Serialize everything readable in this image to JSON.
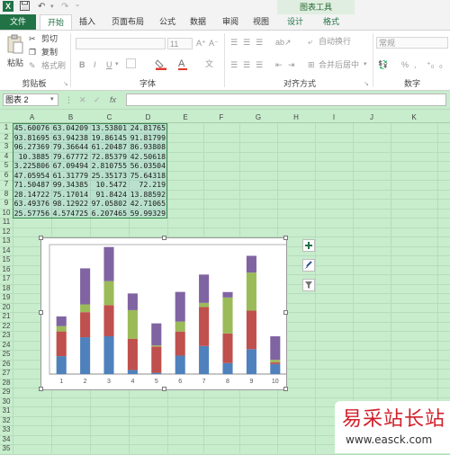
{
  "quick_access": {
    "save_icon": "save-icon",
    "undo": "↶",
    "redo": "↷"
  },
  "chart_tools_label": "图表工具",
  "tabs": [
    {
      "label": "文件",
      "kind": "file"
    },
    {
      "label": "开始",
      "kind": "active"
    },
    {
      "label": "插入",
      "kind": "normal"
    },
    {
      "label": "页面布局",
      "kind": "normal"
    },
    {
      "label": "公式",
      "kind": "normal"
    },
    {
      "label": "数据",
      "kind": "normal"
    },
    {
      "label": "审阅",
      "kind": "normal"
    },
    {
      "label": "视图",
      "kind": "normal"
    },
    {
      "label": "设计",
      "kind": "ctx"
    },
    {
      "label": "格式",
      "kind": "ctx"
    }
  ],
  "ribbon": {
    "paste_label": "粘贴",
    "cut_label": "剪切",
    "copy_label": "复制",
    "format_painter_label": "格式刷",
    "clipboard_group": "剪贴板",
    "font_size": "11",
    "bold": "B",
    "italic": "I",
    "underline": "U",
    "font_group": "字体",
    "wrap_text_label": "自动换行",
    "merge_label": "合并后居中",
    "alignment_group": "对齐方式",
    "number_format": "常规",
    "percent": "%",
    "number_group": "数字"
  },
  "formula_bar": {
    "name_box": "图表 2",
    "fx": "fx"
  },
  "columns": [
    "A",
    "B",
    "C",
    "D",
    "E",
    "F",
    "G",
    "H",
    "I",
    "J",
    "K"
  ],
  "rows": [
    1,
    2,
    3,
    4,
    5,
    6,
    7,
    8,
    9,
    10,
    11,
    12,
    13,
    14,
    15,
    16,
    17,
    18,
    19,
    20,
    21,
    22,
    23,
    24,
    25,
    26,
    27,
    28,
    29,
    30,
    31,
    32,
    33,
    34,
    35,
    36
  ],
  "table": [
    [
      "45.60076",
      "63.04209",
      "13.53801",
      "24.81765"
    ],
    [
      "93.81695",
      "63.94238",
      "19.86145",
      "91.81799"
    ],
    [
      "96.27369",
      "79.36644",
      "61.20487",
      "86.93808"
    ],
    [
      "10.3885",
      "79.67772",
      "72.85379",
      "42.50618"
    ],
    [
      "3.225806",
      "67.09494",
      "2.810755",
      "56.03504"
    ],
    [
      "47.05954",
      "61.31779",
      "25.35173",
      "75.64318"
    ],
    [
      "71.50487",
      "99.34385",
      "10.5472",
      "72.219"
    ],
    [
      "28.14722",
      "75.17014",
      "91.8424",
      "13.88592"
    ],
    [
      "63.49376",
      "98.12922",
      "97.05802",
      "42.71065"
    ],
    [
      "25.57756",
      "4.574725",
      "6.207465",
      "59.99329"
    ]
  ],
  "chart_data": {
    "type": "bar",
    "stacked": true,
    "categories": [
      "1",
      "2",
      "3",
      "4",
      "5",
      "6",
      "7",
      "8",
      "9",
      "10"
    ],
    "series": [
      {
        "values": [
          45.60076,
          93.81695,
          96.27369,
          10.3885,
          3.225806,
          47.05954,
          71.50487,
          28.14722,
          63.49376,
          25.57756
        ],
        "color": "#4f81bd"
      },
      {
        "values": [
          63.04209,
          63.94238,
          79.36644,
          79.67772,
          67.09494,
          61.31779,
          99.34385,
          75.17014,
          98.12922,
          4.574725
        ],
        "color": "#c0504d"
      },
      {
        "values": [
          13.53801,
          19.86145,
          61.20487,
          72.85379,
          2.810755,
          25.35173,
          10.5472,
          91.8424,
          97.05802,
          6.207465
        ],
        "color": "#9bbb59"
      },
      {
        "values": [
          24.81765,
          91.81799,
          86.93808,
          42.50618,
          56.03504,
          75.64318,
          72.219,
          13.88592,
          42.71065,
          59.99329
        ],
        "color": "#8064a2"
      }
    ],
    "ylim": [
      0,
      330
    ],
    "grid": false,
    "legend": "none",
    "title": "",
    "xlabel": "",
    "ylabel": ""
  },
  "chart_side_buttons": [
    "plus-icon",
    "brush-icon",
    "filter-icon"
  ],
  "watermark": {
    "text": "易采站长站",
    "url": "www.easck.com"
  }
}
